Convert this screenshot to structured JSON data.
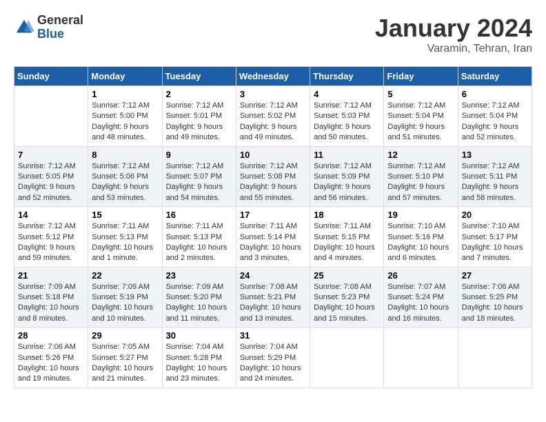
{
  "logo": {
    "general": "General",
    "blue": "Blue"
  },
  "title": {
    "month": "January 2024",
    "location": "Varamin, Tehran, Iran"
  },
  "days_of_week": [
    "Sunday",
    "Monday",
    "Tuesday",
    "Wednesday",
    "Thursday",
    "Friday",
    "Saturday"
  ],
  "weeks": [
    [
      {
        "num": "",
        "sunrise": "",
        "sunset": "",
        "daylight": ""
      },
      {
        "num": "1",
        "sunrise": "Sunrise: 7:12 AM",
        "sunset": "Sunset: 5:00 PM",
        "daylight": "Daylight: 9 hours and 48 minutes."
      },
      {
        "num": "2",
        "sunrise": "Sunrise: 7:12 AM",
        "sunset": "Sunset: 5:01 PM",
        "daylight": "Daylight: 9 hours and 49 minutes."
      },
      {
        "num": "3",
        "sunrise": "Sunrise: 7:12 AM",
        "sunset": "Sunset: 5:02 PM",
        "daylight": "Daylight: 9 hours and 49 minutes."
      },
      {
        "num": "4",
        "sunrise": "Sunrise: 7:12 AM",
        "sunset": "Sunset: 5:03 PM",
        "daylight": "Daylight: 9 hours and 50 minutes."
      },
      {
        "num": "5",
        "sunrise": "Sunrise: 7:12 AM",
        "sunset": "Sunset: 5:04 PM",
        "daylight": "Daylight: 9 hours and 51 minutes."
      },
      {
        "num": "6",
        "sunrise": "Sunrise: 7:12 AM",
        "sunset": "Sunset: 5:04 PM",
        "daylight": "Daylight: 9 hours and 52 minutes."
      }
    ],
    [
      {
        "num": "7",
        "sunrise": "Sunrise: 7:12 AM",
        "sunset": "Sunset: 5:05 PM",
        "daylight": "Daylight: 9 hours and 52 minutes."
      },
      {
        "num": "8",
        "sunrise": "Sunrise: 7:12 AM",
        "sunset": "Sunset: 5:06 PM",
        "daylight": "Daylight: 9 hours and 53 minutes."
      },
      {
        "num": "9",
        "sunrise": "Sunrise: 7:12 AM",
        "sunset": "Sunset: 5:07 PM",
        "daylight": "Daylight: 9 hours and 54 minutes."
      },
      {
        "num": "10",
        "sunrise": "Sunrise: 7:12 AM",
        "sunset": "Sunset: 5:08 PM",
        "daylight": "Daylight: 9 hours and 55 minutes."
      },
      {
        "num": "11",
        "sunrise": "Sunrise: 7:12 AM",
        "sunset": "Sunset: 5:09 PM",
        "daylight": "Daylight: 9 hours and 56 minutes."
      },
      {
        "num": "12",
        "sunrise": "Sunrise: 7:12 AM",
        "sunset": "Sunset: 5:10 PM",
        "daylight": "Daylight: 9 hours and 57 minutes."
      },
      {
        "num": "13",
        "sunrise": "Sunrise: 7:12 AM",
        "sunset": "Sunset: 5:11 PM",
        "daylight": "Daylight: 9 hours and 58 minutes."
      }
    ],
    [
      {
        "num": "14",
        "sunrise": "Sunrise: 7:12 AM",
        "sunset": "Sunset: 5:12 PM",
        "daylight": "Daylight: 9 hours and 59 minutes."
      },
      {
        "num": "15",
        "sunrise": "Sunrise: 7:11 AM",
        "sunset": "Sunset: 5:13 PM",
        "daylight": "Daylight: 10 hours and 1 minute."
      },
      {
        "num": "16",
        "sunrise": "Sunrise: 7:11 AM",
        "sunset": "Sunset: 5:13 PM",
        "daylight": "Daylight: 10 hours and 2 minutes."
      },
      {
        "num": "17",
        "sunrise": "Sunrise: 7:11 AM",
        "sunset": "Sunset: 5:14 PM",
        "daylight": "Daylight: 10 hours and 3 minutes."
      },
      {
        "num": "18",
        "sunrise": "Sunrise: 7:11 AM",
        "sunset": "Sunset: 5:15 PM",
        "daylight": "Daylight: 10 hours and 4 minutes."
      },
      {
        "num": "19",
        "sunrise": "Sunrise: 7:10 AM",
        "sunset": "Sunset: 5:16 PM",
        "daylight": "Daylight: 10 hours and 6 minutes."
      },
      {
        "num": "20",
        "sunrise": "Sunrise: 7:10 AM",
        "sunset": "Sunset: 5:17 PM",
        "daylight": "Daylight: 10 hours and 7 minutes."
      }
    ],
    [
      {
        "num": "21",
        "sunrise": "Sunrise: 7:09 AM",
        "sunset": "Sunset: 5:18 PM",
        "daylight": "Daylight: 10 hours and 8 minutes."
      },
      {
        "num": "22",
        "sunrise": "Sunrise: 7:09 AM",
        "sunset": "Sunset: 5:19 PM",
        "daylight": "Daylight: 10 hours and 10 minutes."
      },
      {
        "num": "23",
        "sunrise": "Sunrise: 7:09 AM",
        "sunset": "Sunset: 5:20 PM",
        "daylight": "Daylight: 10 hours and 11 minutes."
      },
      {
        "num": "24",
        "sunrise": "Sunrise: 7:08 AM",
        "sunset": "Sunset: 5:21 PM",
        "daylight": "Daylight: 10 hours and 13 minutes."
      },
      {
        "num": "25",
        "sunrise": "Sunrise: 7:08 AM",
        "sunset": "Sunset: 5:23 PM",
        "daylight": "Daylight: 10 hours and 15 minutes."
      },
      {
        "num": "26",
        "sunrise": "Sunrise: 7:07 AM",
        "sunset": "Sunset: 5:24 PM",
        "daylight": "Daylight: 10 hours and 16 minutes."
      },
      {
        "num": "27",
        "sunrise": "Sunrise: 7:06 AM",
        "sunset": "Sunset: 5:25 PM",
        "daylight": "Daylight: 10 hours and 18 minutes."
      }
    ],
    [
      {
        "num": "28",
        "sunrise": "Sunrise: 7:06 AM",
        "sunset": "Sunset: 5:26 PM",
        "daylight": "Daylight: 10 hours and 19 minutes."
      },
      {
        "num": "29",
        "sunrise": "Sunrise: 7:05 AM",
        "sunset": "Sunset: 5:27 PM",
        "daylight": "Daylight: 10 hours and 21 minutes."
      },
      {
        "num": "30",
        "sunrise": "Sunrise: 7:04 AM",
        "sunset": "Sunset: 5:28 PM",
        "daylight": "Daylight: 10 hours and 23 minutes."
      },
      {
        "num": "31",
        "sunrise": "Sunrise: 7:04 AM",
        "sunset": "Sunset: 5:29 PM",
        "daylight": "Daylight: 10 hours and 24 minutes."
      },
      {
        "num": "",
        "sunrise": "",
        "sunset": "",
        "daylight": ""
      },
      {
        "num": "",
        "sunrise": "",
        "sunset": "",
        "daylight": ""
      },
      {
        "num": "",
        "sunrise": "",
        "sunset": "",
        "daylight": ""
      }
    ]
  ]
}
